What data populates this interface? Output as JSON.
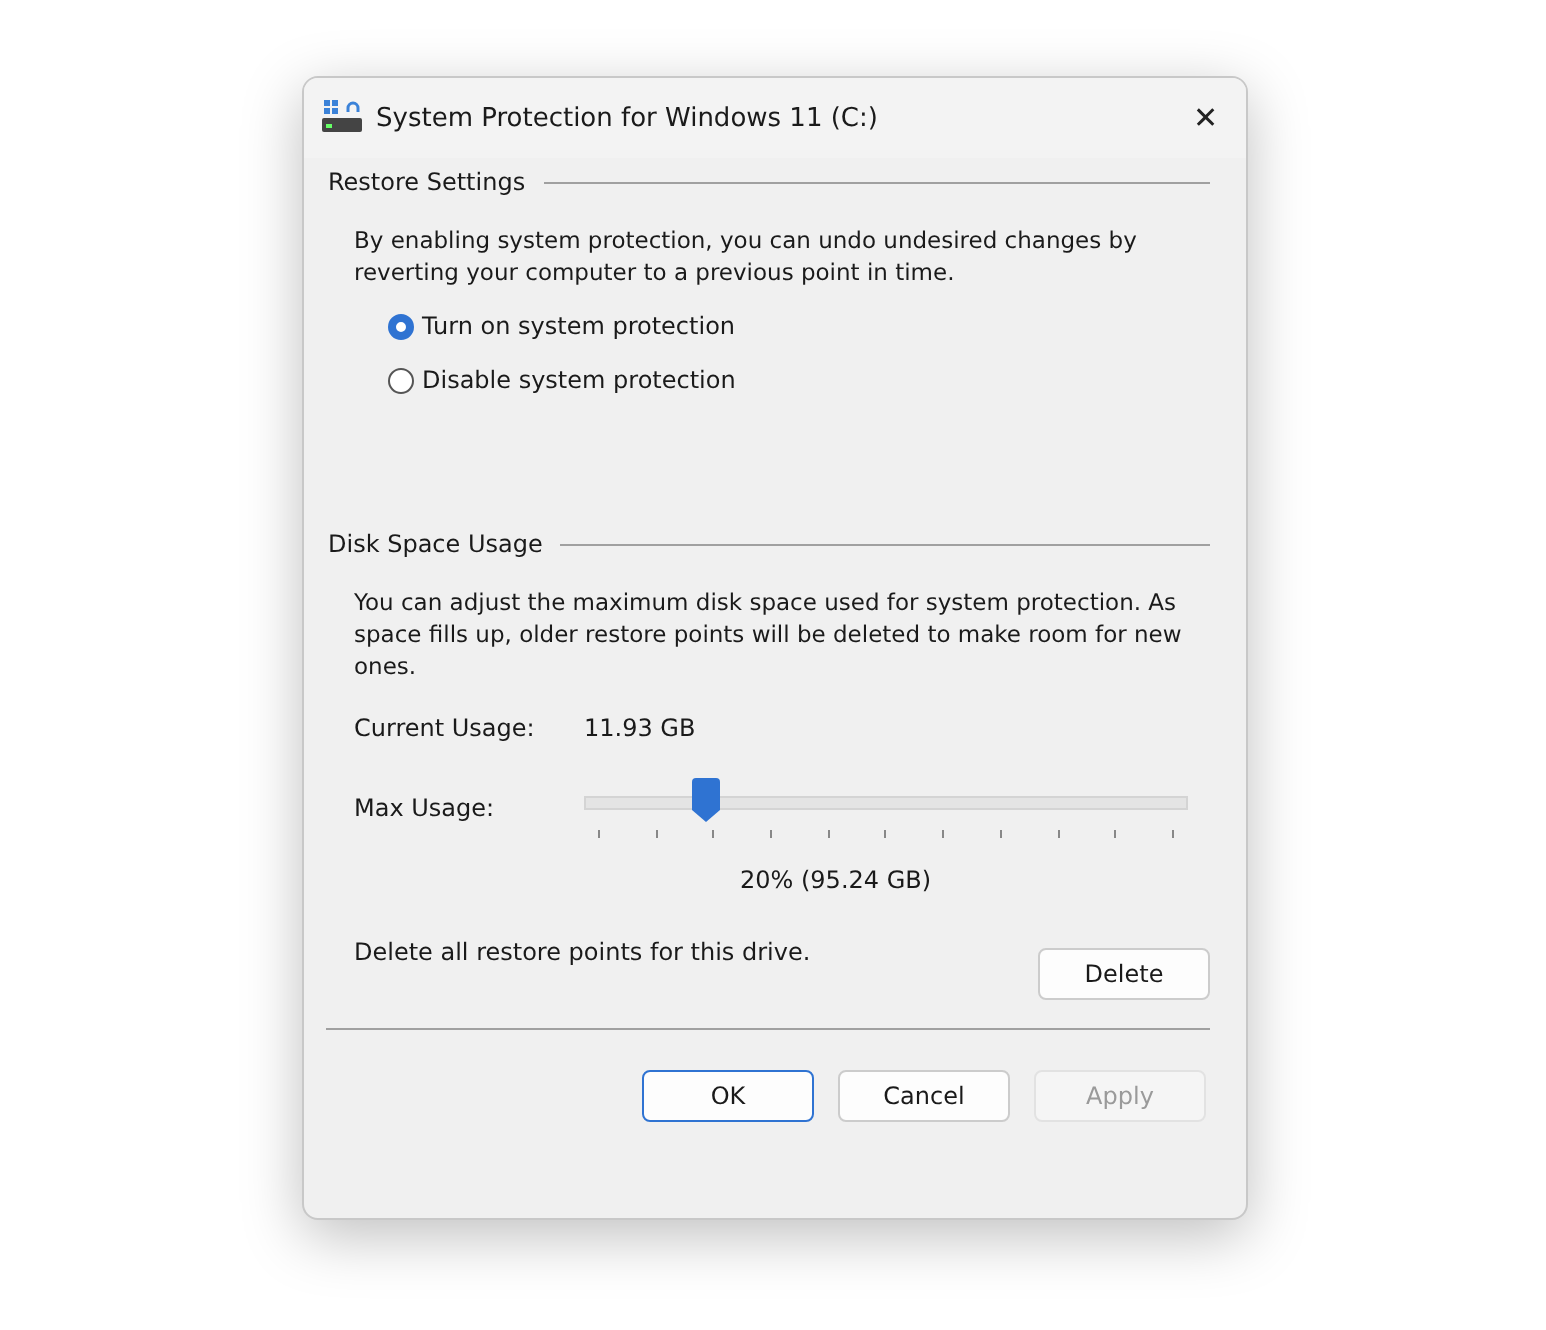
{
  "window": {
    "title": "System Protection for Windows 11 (C:)",
    "close": "✕"
  },
  "restore_settings": {
    "heading": "Restore Settings",
    "description": "By enabling system protection, you can undo undesired changes by reverting your computer to a previous point in time.",
    "options": [
      {
        "label": "Turn on system protection",
        "selected": true
      },
      {
        "label": "Disable system protection",
        "selected": false
      }
    ]
  },
  "disk_space": {
    "heading": "Disk Space Usage",
    "description": "You can adjust the maximum disk space used for system protection. As space fills up, older restore points will be deleted to make room for new ones.",
    "current_usage_label": "Current Usage:",
    "current_usage_value": "11.93 GB",
    "max_usage_label": "Max Usage:",
    "slider": {
      "level": 0.2
    },
    "slider_reading": "20% (95.24 GB)",
    "delete_text": "Delete all restore points for this drive.",
    "delete_button": "Delete"
  },
  "buttons": [
    {
      "label": "OK",
      "kind": "default",
      "disabled": false
    },
    {
      "label": "Cancel",
      "kind": "normal",
      "disabled": false
    },
    {
      "label": "Apply",
      "kind": "normal",
      "disabled": true
    }
  ]
}
